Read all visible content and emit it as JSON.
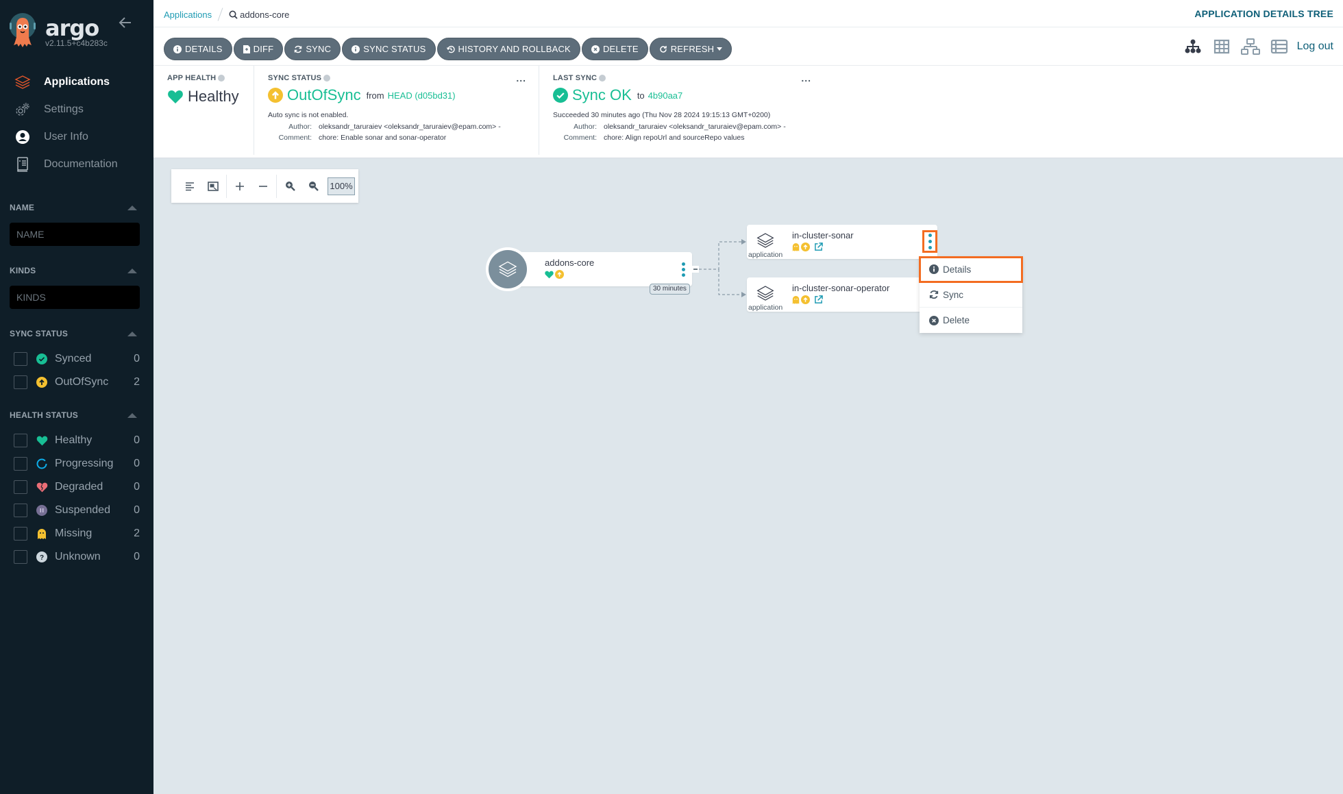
{
  "app": {
    "brand": "argo",
    "version": "v2.11.5+c4b283c"
  },
  "sidebar": {
    "nav": [
      {
        "label": "Applications",
        "icon": "layers-icon",
        "active": true
      },
      {
        "label": "Settings",
        "icon": "gears-icon",
        "active": false
      },
      {
        "label": "User Info",
        "icon": "user-circle-icon",
        "active": false
      },
      {
        "label": "Documentation",
        "icon": "book-icon",
        "active": false
      }
    ],
    "filters": {
      "name": {
        "title": "NAME",
        "placeholder": "NAME",
        "value": ""
      },
      "kinds": {
        "title": "KINDS",
        "placeholder": "KINDS",
        "value": ""
      },
      "sync_status": {
        "title": "SYNC STATUS",
        "items": [
          {
            "label": "Synced",
            "count": "0",
            "icon": "check-circle-icon",
            "color": "#18be94"
          },
          {
            "label": "OutOfSync",
            "count": "2",
            "icon": "arrow-up-circle-icon",
            "color": "#f4c030"
          }
        ]
      },
      "health_status": {
        "title": "HEALTH STATUS",
        "items": [
          {
            "label": "Healthy",
            "count": "0",
            "icon": "heart-icon",
            "color": "#18be94"
          },
          {
            "label": "Progressing",
            "count": "0",
            "icon": "progress-circle-icon",
            "color": "#0dadea"
          },
          {
            "label": "Degraded",
            "count": "0",
            "icon": "broken-heart-icon",
            "color": "#e96d76"
          },
          {
            "label": "Suspended",
            "count": "0",
            "icon": "pause-circle-icon",
            "color": "#766f94"
          },
          {
            "label": "Missing",
            "count": "2",
            "icon": "ghost-icon",
            "color": "#f4c030"
          },
          {
            "label": "Unknown",
            "count": "0",
            "icon": "question-circle-icon",
            "color": "#ccd6dd"
          }
        ]
      }
    }
  },
  "topbar": {
    "breadcrumb_root": "Applications",
    "breadcrumb_current": "addons-core",
    "page_title": "APPLICATION DETAILS TREE",
    "logout": "Log out"
  },
  "toolbar": {
    "buttons": [
      {
        "label": "DETAILS",
        "icon": "info-circle-icon"
      },
      {
        "label": "DIFF",
        "icon": "file-diff-icon"
      },
      {
        "label": "SYNC",
        "icon": "sync-icon"
      },
      {
        "label": "SYNC STATUS",
        "icon": "info-circle-icon"
      },
      {
        "label": "HISTORY AND ROLLBACK",
        "icon": "history-icon"
      },
      {
        "label": "DELETE",
        "icon": "times-circle-icon"
      },
      {
        "label": "REFRESH",
        "icon": "redo-icon",
        "dropdown": true
      }
    ],
    "views": [
      "tree-view-icon",
      "pods-grid-view-icon",
      "network-view-icon",
      "list-view-icon"
    ]
  },
  "status": {
    "app_health": {
      "title": "APP HEALTH",
      "value": "Healthy"
    },
    "sync_status": {
      "title": "SYNC STATUS",
      "value": "OutOfSync",
      "from_label": "from",
      "revision": "HEAD (d05bd31)",
      "auto_sync": "Auto sync is not enabled.",
      "author_label": "Author:",
      "author": "oleksandr_taruraiev <oleksandr_taruraiev@epam.com> -",
      "comment_label": "Comment:",
      "comment": "chore: Enable sonar and sonar-operator",
      "more": "..."
    },
    "last_sync": {
      "title": "LAST SYNC",
      "value": "Sync OK",
      "to_label": "to",
      "revision": "4b90aa7",
      "succeeded": "Succeeded 30 minutes ago (Thu Nov 28 2024 19:15:13 GMT+0200)",
      "author_label": "Author:",
      "author": "oleksandr_taruraiev <oleksandr_taruraiev@epam.com> -",
      "comment_label": "Comment:",
      "comment": "chore: Align repoUrl and sourceRepo values",
      "more": "..."
    }
  },
  "graph": {
    "zoom": "100%",
    "root": {
      "name": "addons-core",
      "age": "30 minutes"
    },
    "children": [
      {
        "name": "in-cluster-sonar",
        "kind": "application"
      },
      {
        "name": "in-cluster-sonar-operator",
        "kind": "application"
      }
    ],
    "context_menu": [
      {
        "label": "Details",
        "icon": "info-circle-icon"
      },
      {
        "label": "Sync",
        "icon": "sync-icon"
      },
      {
        "label": "Delete",
        "icon": "times-circle-icon"
      }
    ]
  },
  "colors": {
    "accent_orange": "#f36c21",
    "teal": "#1f9bb3",
    "green": "#18be94",
    "yellow": "#f4c030",
    "sidebar_bg": "#0f1e28",
    "button_bg": "#5d6d7a"
  }
}
